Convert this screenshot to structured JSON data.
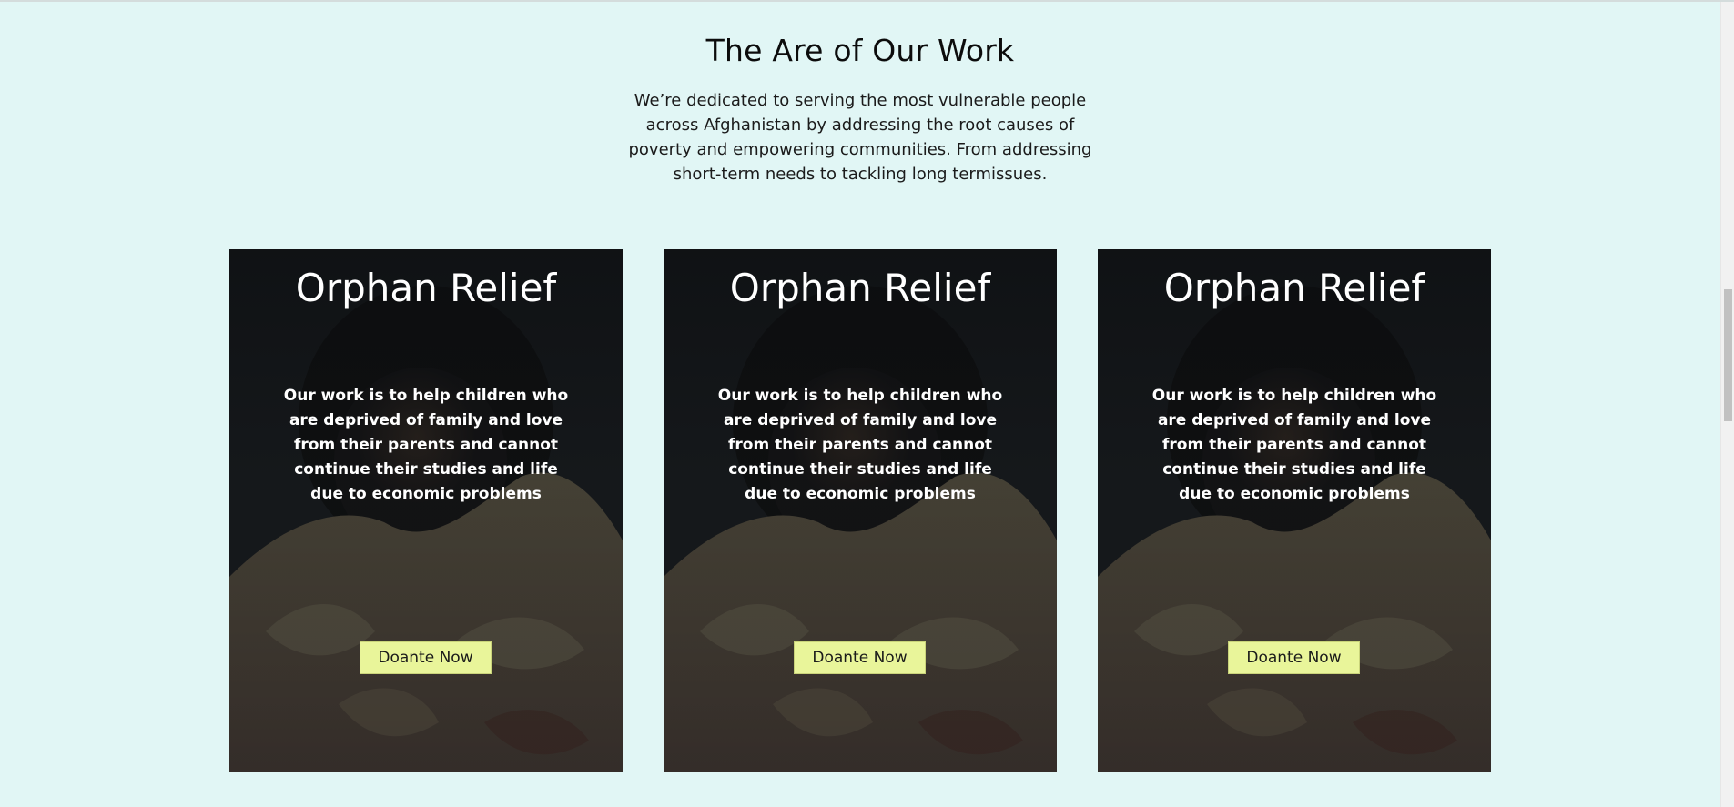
{
  "section": {
    "title": "The Are of Our Work",
    "intro": "We’re dedicated to serving the most vulnerable people across Afghanistan by addressing the root causes of poverty and empowering communities. From addressing short-term needs to tackling long termissues."
  },
  "cards": [
    {
      "title": "Orphan Relief",
      "text": "Our work is to help children who are deprived of family and love from their parents and cannot continue their studies and life due to economic problems",
      "button_label": "Doante Now"
    },
    {
      "title": "Orphan Relief",
      "text": "Our work is to help children who are deprived of family and love from their parents and cannot continue their studies and life due to economic problems",
      "button_label": "Doante Now"
    },
    {
      "title": "Orphan Relief",
      "text": "Our work is to help children who are deprived of family and love from their parents and cannot continue their studies and life due to economic problems",
      "button_label": "Doante Now"
    }
  ],
  "colors": {
    "page_background": "#e1f6f5",
    "button_background": "#e9f59a",
    "card_text": "#ffffff"
  }
}
